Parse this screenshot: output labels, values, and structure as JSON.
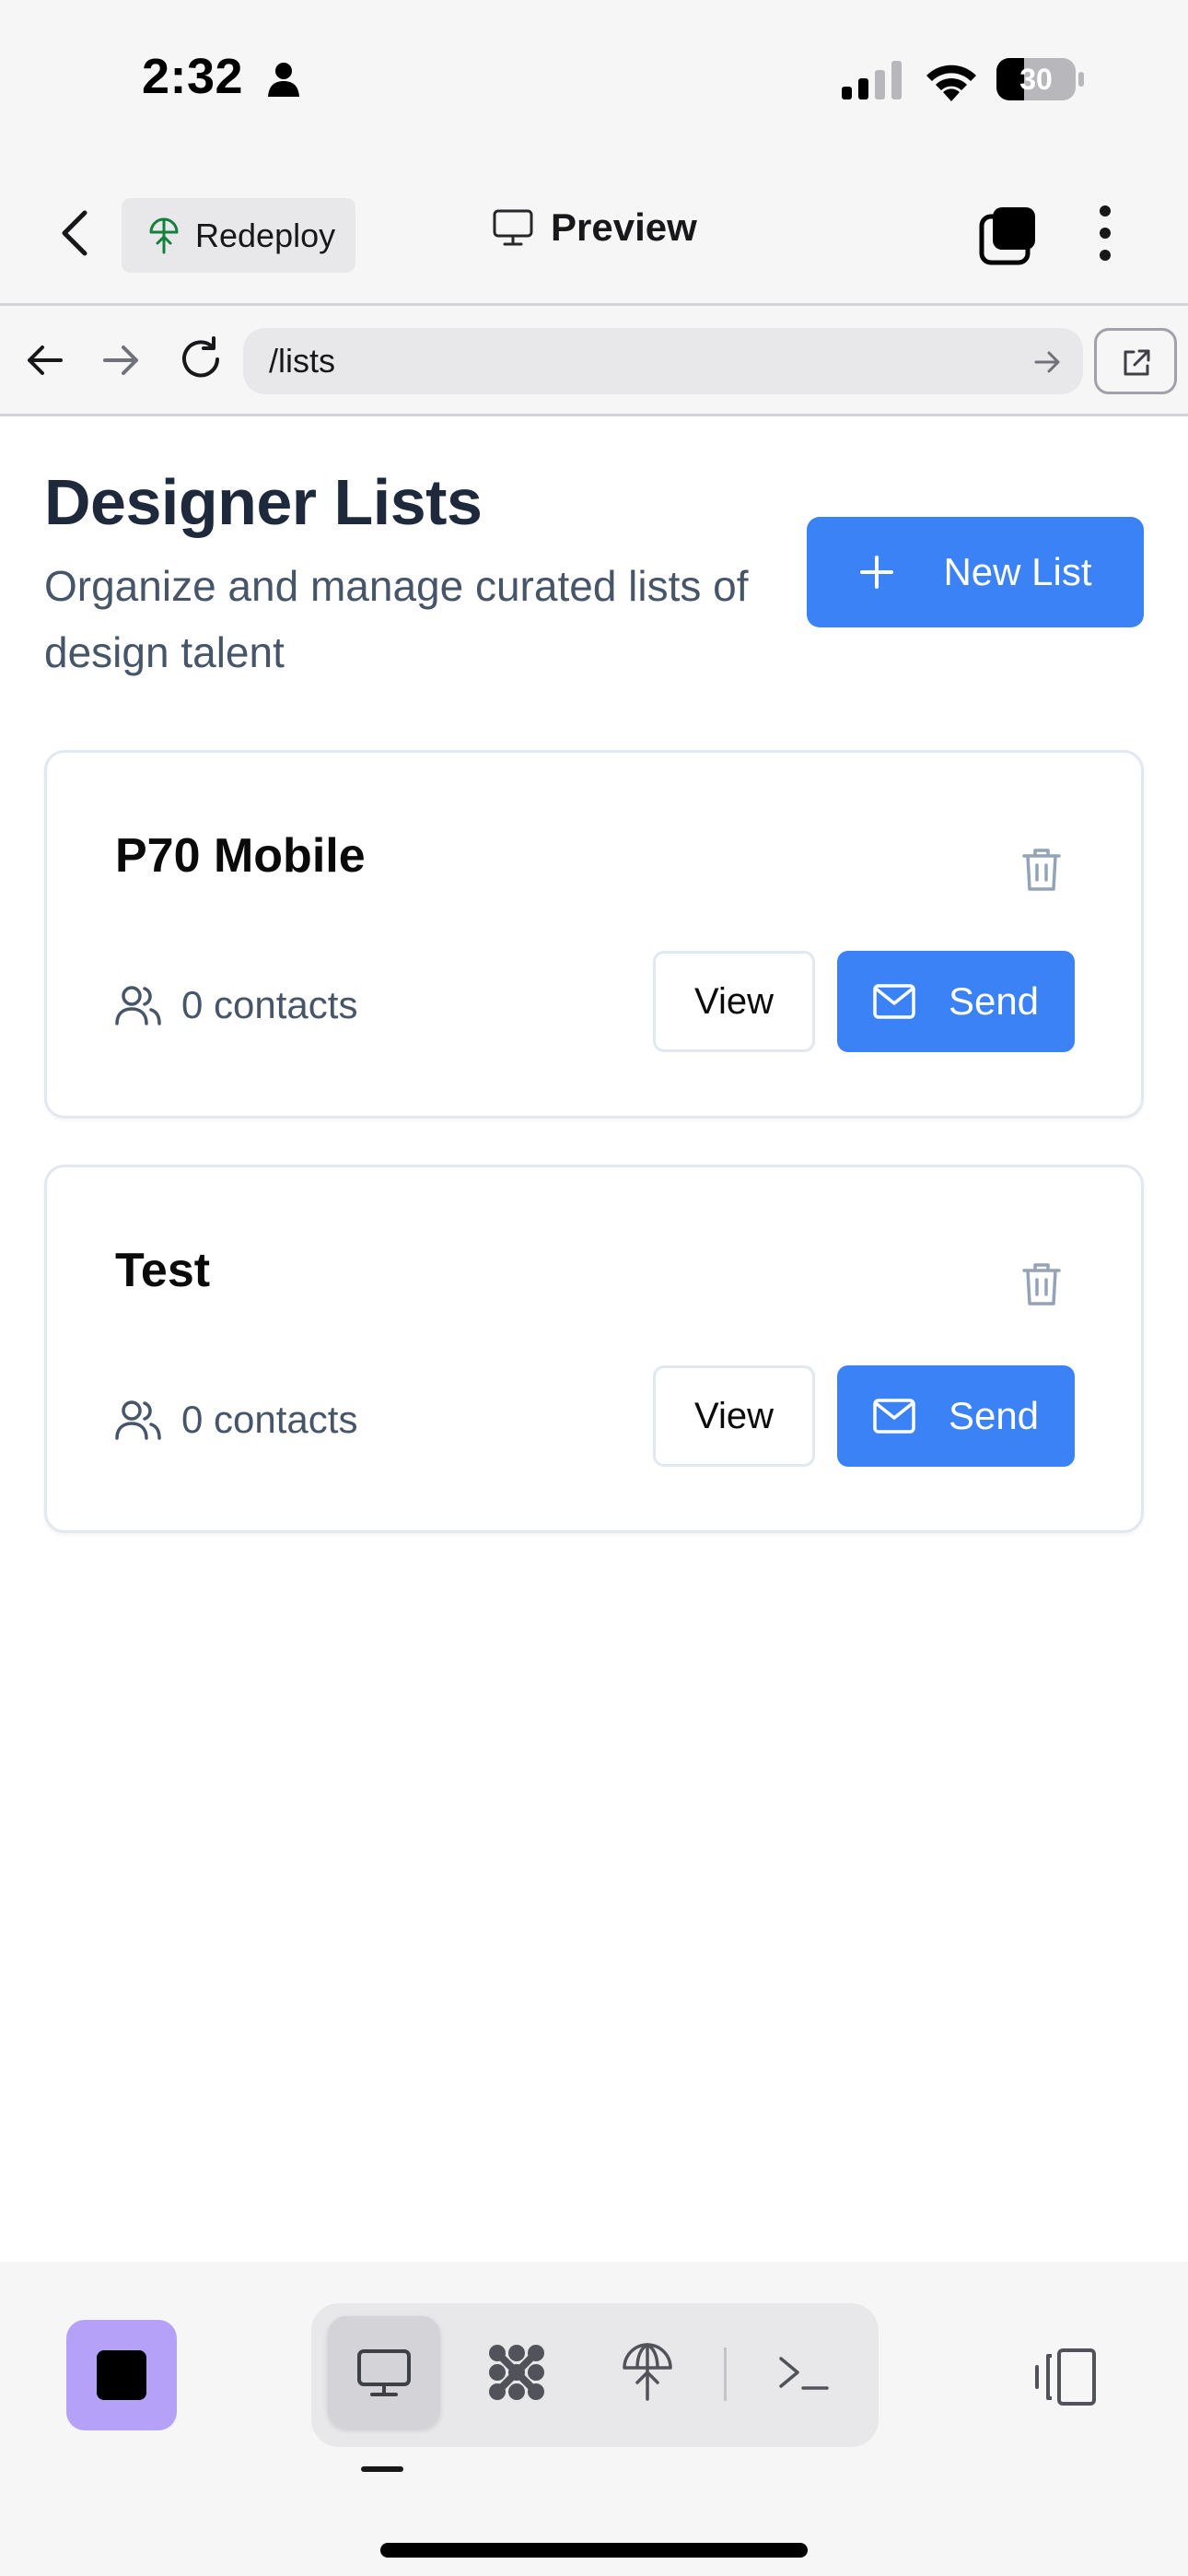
{
  "status_bar": {
    "time": "2:32",
    "battery": "30",
    "icons": [
      "person-icon",
      "cellular-signal-icon",
      "wifi-icon",
      "battery-icon"
    ]
  },
  "app_header": {
    "redeploy_label": "Redeploy",
    "preview_label": "Preview",
    "icons": [
      "back-chevron-icon",
      "redeploy-icon",
      "desktop-icon",
      "tabs-icon",
      "more-vertical-icon"
    ]
  },
  "browser_bar": {
    "url": "/lists",
    "icons": [
      "arrow-left-icon",
      "arrow-right-icon",
      "reload-icon",
      "go-arrow-icon",
      "open-external-icon"
    ]
  },
  "main": {
    "title": "Designer Lists",
    "subtitle": "Organize and manage curated lists of design talent",
    "new_list_label": "New List",
    "lists": [
      {
        "name": "P70 Mobile",
        "contacts": "0 contacts",
        "view_label": "View",
        "send_label": "Send"
      },
      {
        "name": "Test",
        "contacts": "0 contacts",
        "view_label": "View",
        "send_label": "Send"
      }
    ]
  },
  "bottom_bar": {
    "icons": [
      "stop-icon",
      "desktop-icon",
      "workflow-icon",
      "deploy-icon",
      "terminal-icon",
      "device-toggle-icon"
    ],
    "active_tab": "desktop"
  },
  "colors": {
    "accent": "#3b82f6",
    "stop_button": "#b5a2f8",
    "title": "#1e293b",
    "subtitle": "#475569"
  }
}
